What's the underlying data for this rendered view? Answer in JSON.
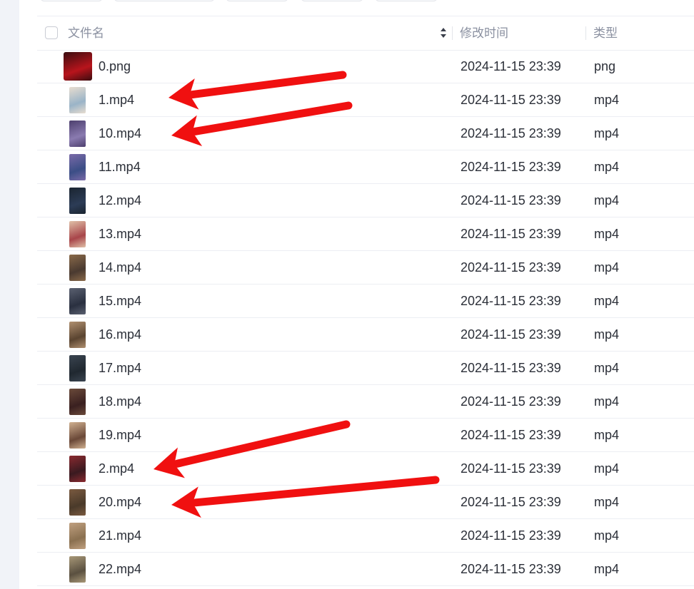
{
  "header": {
    "name_label": "文件名",
    "mtime_label": "修改时间",
    "type_label": "类型"
  },
  "files": [
    {
      "name": "0.png",
      "mtime": "2024-11-15 23:39",
      "type": "png",
      "thumb": [
        "#b8141c",
        "#3a0d10"
      ]
    },
    {
      "name": "1.mp4",
      "mtime": "2024-11-15 23:39",
      "type": "mp4",
      "thumb": [
        "#9ab4c8",
        "#e8ddd0"
      ]
    },
    {
      "name": "10.mp4",
      "mtime": "2024-11-15 23:39",
      "type": "mp4",
      "thumb": [
        "#8a7bb0",
        "#4d3f6e"
      ]
    },
    {
      "name": "11.mp4",
      "mtime": "2024-11-15 23:39",
      "type": "mp4",
      "thumb": [
        "#3b4e86",
        "#7a6aa8"
      ]
    },
    {
      "name": "12.mp4",
      "mtime": "2024-11-15 23:39",
      "type": "mp4",
      "thumb": [
        "#2c3c56",
        "#1a2430"
      ]
    },
    {
      "name": "13.mp4",
      "mtime": "2024-11-15 23:39",
      "type": "mp4",
      "thumb": [
        "#a8454a",
        "#e0c0a8"
      ]
    },
    {
      "name": "14.mp4",
      "mtime": "2024-11-15 23:39",
      "type": "mp4",
      "thumb": [
        "#4a3a30",
        "#8a6a4a"
      ]
    },
    {
      "name": "15.mp4",
      "mtime": "2024-11-15 23:39",
      "type": "mp4",
      "thumb": [
        "#2a3040",
        "#5a6070"
      ]
    },
    {
      "name": "16.mp4",
      "mtime": "2024-11-15 23:39",
      "type": "mp4",
      "thumb": [
        "#5a4430",
        "#b09070"
      ]
    },
    {
      "name": "17.mp4",
      "mtime": "2024-11-15 23:39",
      "type": "mp4",
      "thumb": [
        "#202830",
        "#3a4450"
      ]
    },
    {
      "name": "18.mp4",
      "mtime": "2024-11-15 23:39",
      "type": "mp4",
      "thumb": [
        "#3a2020",
        "#6a4a3a"
      ]
    },
    {
      "name": "19.mp4",
      "mtime": "2024-11-15 23:39",
      "type": "mp4",
      "thumb": [
        "#6a4838",
        "#d0b090"
      ]
    },
    {
      "name": "2.mp4",
      "mtime": "2024-11-15 23:39",
      "type": "mp4",
      "thumb": [
        "#3a1a20",
        "#8a2a30"
      ]
    },
    {
      "name": "20.mp4",
      "mtime": "2024-11-15 23:39",
      "type": "mp4",
      "thumb": [
        "#4a3a2a",
        "#7a5a40"
      ]
    },
    {
      "name": "21.mp4",
      "mtime": "2024-11-15 23:39",
      "type": "mp4",
      "thumb": [
        "#8a7050",
        "#c0a080"
      ]
    },
    {
      "name": "22.mp4",
      "mtime": "2024-11-15 23:39",
      "type": "mp4",
      "thumb": [
        "#5a5040",
        "#a89878"
      ]
    }
  ],
  "annotation_color": "#f01010"
}
